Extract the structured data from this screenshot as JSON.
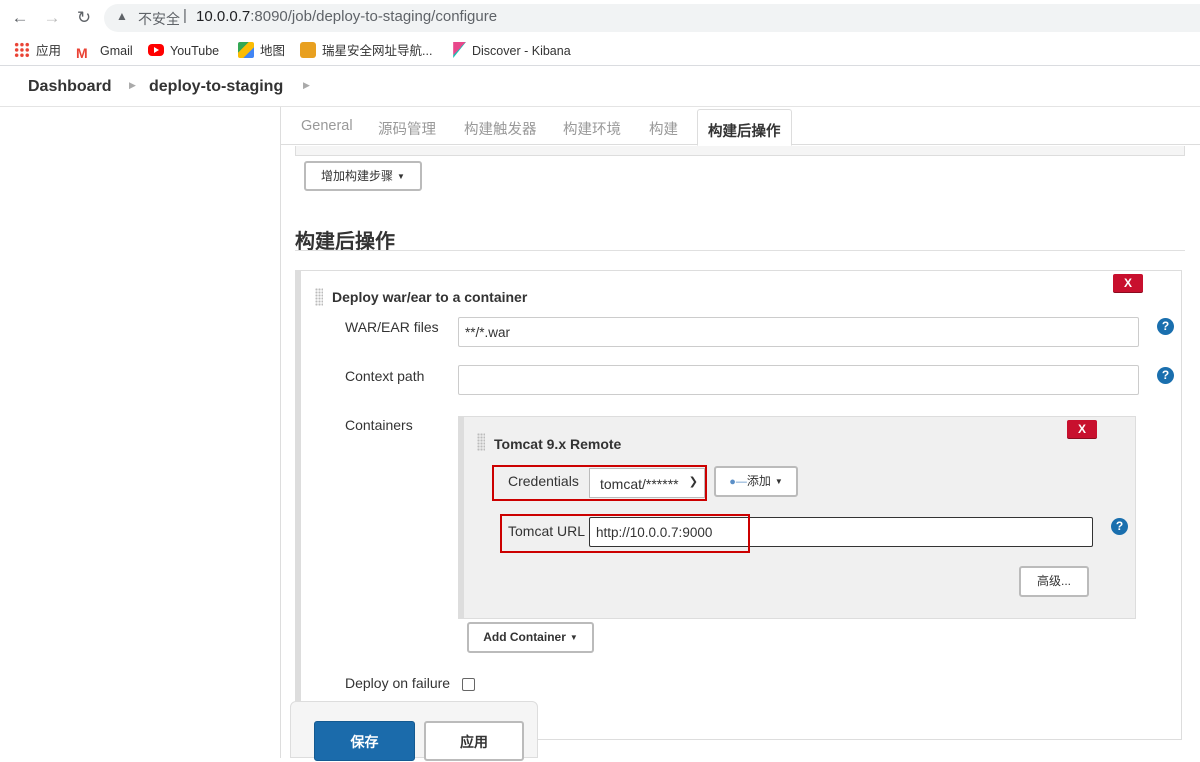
{
  "browser": {
    "security_label": "不安全",
    "separator": "|",
    "url_host": "10.0.0.7",
    "url_rest": ":8090/job/deploy-to-staging/configure",
    "bookmarks": [
      {
        "label": "应用"
      },
      {
        "label": "Gmail"
      },
      {
        "label": "YouTube"
      },
      {
        "label": "地图"
      },
      {
        "label": "瑞星安全网址导航..."
      },
      {
        "label": "Discover - Kibana"
      }
    ]
  },
  "breadcrumb": {
    "items": [
      "Dashboard",
      "deploy-to-staging"
    ]
  },
  "tabs": [
    "General",
    "源码管理",
    "构建触发器",
    "构建环境",
    "构建",
    "构建后操作"
  ],
  "active_tab": "构建后操作",
  "add_build_step_label": "增加构建步骤",
  "post_build": {
    "section_title": "构建后操作",
    "step_title": "Deploy war/ear to a container",
    "delete_label": "X",
    "war_files_label": "WAR/EAR files",
    "war_files_value": "**/*.war",
    "context_path_label": "Context path",
    "context_path_value": "",
    "containers_label": "Containers",
    "container": {
      "title": "Tomcat 9.x Remote",
      "delete_label": "X",
      "credentials_label": "Credentials",
      "credentials_value": "tomcat/******",
      "add_credentials_label": "添加",
      "tomcat_url_label": "Tomcat URL",
      "tomcat_url_value": "http://10.0.0.7:9000",
      "advanced_label": "高级..."
    },
    "add_container_label": "Add Container",
    "deploy_on_failure_label": "Deploy on failure",
    "deploy_on_failure_checked": false
  },
  "help_symbol": "?",
  "footer": {
    "save_label": "保存",
    "apply_label": "应用"
  },
  "colors": {
    "save_button": "#1b6bab",
    "delete_button": "#c8102e",
    "help_icon": "#1a6fae",
    "highlight_box": "#cc0000"
  }
}
